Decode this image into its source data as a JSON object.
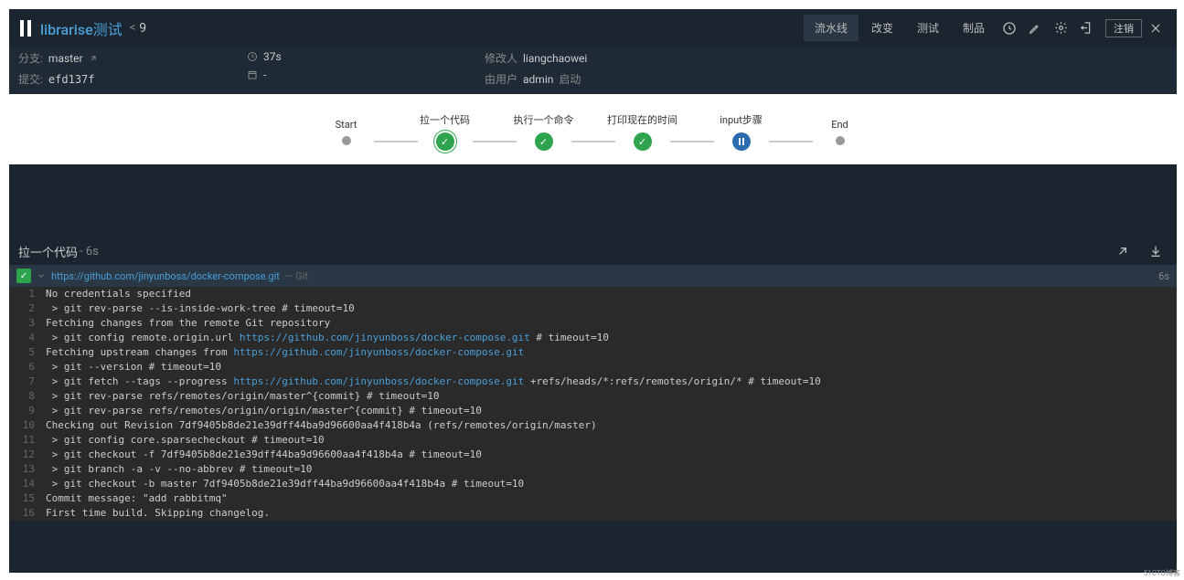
{
  "header": {
    "title": "librarise测试",
    "build_number": "9",
    "tabs": [
      {
        "id": "pipeline",
        "label": "流水线",
        "active": true
      },
      {
        "id": "changes",
        "label": "改变"
      },
      {
        "id": "tests",
        "label": "测试"
      },
      {
        "id": "artifacts",
        "label": "制品"
      }
    ],
    "logout": "注销"
  },
  "info": {
    "branch_label": "分支:",
    "branch_value": "master",
    "commit_label": "提交:",
    "commit_value": "efd137f",
    "duration_value": "37s",
    "dash": "-",
    "modifier_label": "修改人",
    "modifier_value": "liangchaowei",
    "started_by_label": "由用户",
    "started_by_user": "admin",
    "started_by_suffix": "启动"
  },
  "pipeline": {
    "stages": [
      {
        "id": "start",
        "label": "Start",
        "state": "gray"
      },
      {
        "id": "pull",
        "label": "拉一个代码",
        "state": "success-ring"
      },
      {
        "id": "exec",
        "label": "执行一个命令",
        "state": "success"
      },
      {
        "id": "print",
        "label": "打印现在的时间",
        "state": "success"
      },
      {
        "id": "input",
        "label": "input步骤",
        "state": "running"
      },
      {
        "id": "end",
        "label": "End",
        "state": "gray"
      }
    ]
  },
  "log": {
    "title": "拉一个代码",
    "duration_suffix": " - 6s",
    "sub_link": "https://github.com/jinyunboss/docker-compose.git",
    "sub_meta": " — Git",
    "sub_time": "6s",
    "lines": [
      {
        "n": 1,
        "t": "No credentials specified"
      },
      {
        "n": 2,
        "t": " > git rev-parse --is-inside-work-tree # timeout=10"
      },
      {
        "n": 3,
        "t": "Fetching changes from the remote Git repository"
      },
      {
        "n": 4,
        "t": " > git config remote.origin.url ",
        "url": "https://github.com/jinyunboss/docker-compose.git",
        "t2": " # timeout=10"
      },
      {
        "n": 5,
        "t": "Fetching upstream changes from ",
        "url": "https://github.com/jinyunboss/docker-compose.git"
      },
      {
        "n": 6,
        "t": " > git --version # timeout=10"
      },
      {
        "n": 7,
        "t": " > git fetch --tags --progress ",
        "url": "https://github.com/jinyunboss/docker-compose.git",
        "t2": " +refs/heads/*:refs/remotes/origin/* # timeout=10"
      },
      {
        "n": 8,
        "t": " > git rev-parse refs/remotes/origin/master^{commit} # timeout=10"
      },
      {
        "n": 9,
        "t": " > git rev-parse refs/remotes/origin/origin/master^{commit} # timeout=10"
      },
      {
        "n": 10,
        "t": "Checking out Revision 7df9405b8de21e39dff44ba9d96600aa4f418b4a (refs/remotes/origin/master)"
      },
      {
        "n": 11,
        "t": " > git config core.sparsecheckout # timeout=10"
      },
      {
        "n": 12,
        "t": " > git checkout -f 7df9405b8de21e39dff44ba9d96600aa4f418b4a # timeout=10"
      },
      {
        "n": 13,
        "t": " > git branch -a -v --no-abbrev # timeout=10"
      },
      {
        "n": 14,
        "t": " > git checkout -b master 7df9405b8de21e39dff44ba9d96600aa4f418b4a # timeout=10"
      },
      {
        "n": 15,
        "t": "Commit message: \"add rabbitmq\""
      },
      {
        "n": 16,
        "t": "First time build. Skipping changelog."
      }
    ]
  },
  "watermark": "51CTO博客"
}
